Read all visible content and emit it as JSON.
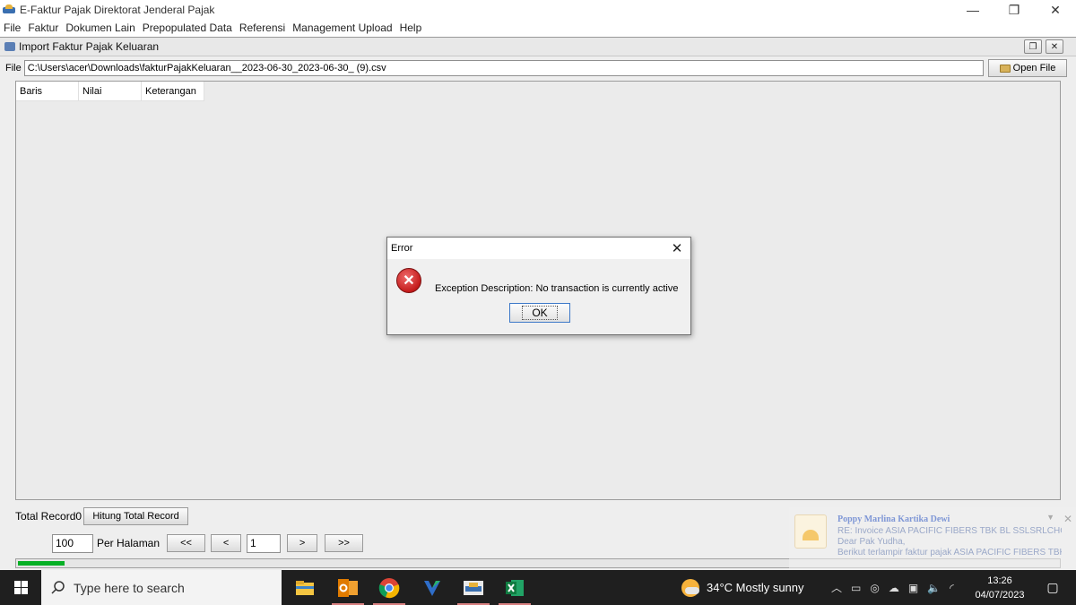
{
  "window": {
    "title": "E-Faktur Pajak Direktorat Jenderal Pajak",
    "minimize": "—",
    "restore": "❐",
    "close": "✕"
  },
  "menu": [
    "File",
    "Faktur",
    "Dokumen Lain",
    "Prepopulated Data",
    "Referensi",
    "Management Upload",
    "Help"
  ],
  "inner_frame": {
    "title": "Import Faktur Pajak Keluaran",
    "file_label": "File",
    "file_path": "C:\\Users\\acer\\Downloads\\fakturPajakKeluaran__2023-06-30_2023-06-30_ (9).csv",
    "open_file_label": "Open File",
    "columns": [
      "Baris",
      "Nilai",
      "Keterangan"
    ],
    "total_record_label": "Total Record",
    "total_record_value": "0",
    "hitung_label": "Hitung Total Record",
    "per_page_value": "100",
    "per_page_label": "Per Halaman",
    "nav_first": "<<",
    "nav_prev": "<",
    "page_value": "1",
    "nav_next": ">",
    "nav_last": ">>",
    "progress_fraction": 0.045
  },
  "dialog": {
    "title": "Error",
    "close": "✕",
    "message": "Exception Description: No transaction is currently active",
    "ok_label": "OK"
  },
  "toast": {
    "sender": "Poppy Marlina Kartika Dewi",
    "subject": "RE: Invoice ASIA PACIFIC FIBERS TBK BL SSLSRLCHCA...",
    "line1": "Dear Pak Yudha,",
    "line2": "Berikut terlampir faktur pajak ASIA PACIFIC FIBERS TBK"
  },
  "taskbar": {
    "search_placeholder": "Type here to search",
    "weather": "34°C  Mostly sunny",
    "time": "13:26",
    "date": "04/07/2023"
  },
  "colors": {
    "progress": "#06b025",
    "taskbar": "#1f1f1f",
    "error": "#c41b1b"
  }
}
